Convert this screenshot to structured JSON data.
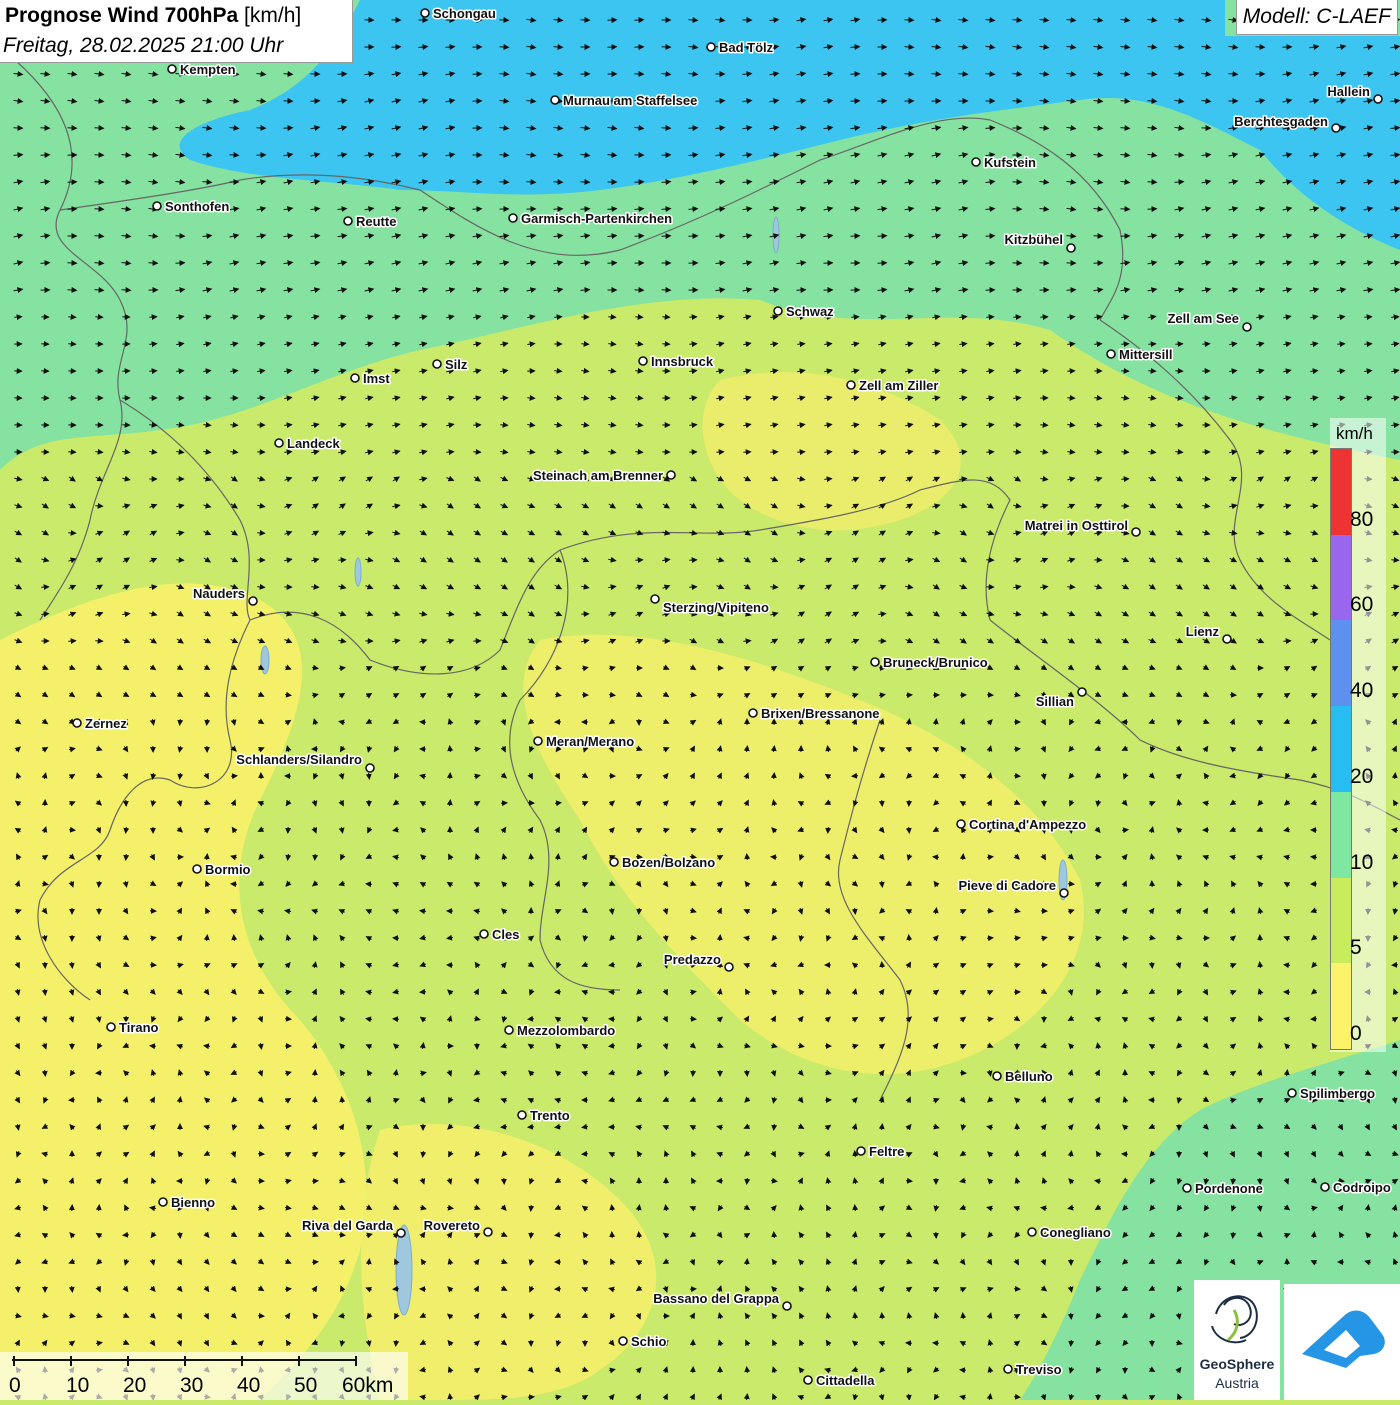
{
  "header": {
    "title_bold": "Prognose Wind 700hPa",
    "title_unit": "[km/h]",
    "datetime": "Freitag, 28.02.2025 21:00 Uhr",
    "model": "Modell: C-LAEF"
  },
  "legend": {
    "unit": "km/h",
    "labels": [
      "0",
      "5",
      "10",
      "20",
      "40",
      "60",
      "80"
    ],
    "colors": [
      "#fdf36a",
      "#c8ec5c",
      "#7fe8a0",
      "#27bdf0",
      "#5e90f0",
      "#9966ee",
      "#ee3333"
    ]
  },
  "scale_bar": {
    "labels": [
      "0",
      "10",
      "20",
      "30",
      "40",
      "50",
      "60km"
    ]
  },
  "logos": {
    "geosphere_line1": "GeoSphere",
    "geosphere_line2": "Austria"
  },
  "cities": [
    {
      "name": "Schongau"
    },
    {
      "name": "Bad Tölz"
    },
    {
      "name": "Kempten"
    },
    {
      "name": "Murnau am Staffelsee"
    },
    {
      "name": "Hallein"
    },
    {
      "name": "Berchtesgaden"
    },
    {
      "name": "Kufstein"
    },
    {
      "name": "Sonthofen"
    },
    {
      "name": "Reutte"
    },
    {
      "name": "Garmisch-Partenkirchen"
    },
    {
      "name": "Kitzbühel"
    },
    {
      "name": "Schwaz"
    },
    {
      "name": "Zell am See"
    },
    {
      "name": "Mittersill"
    },
    {
      "name": "Imst"
    },
    {
      "name": "Silz"
    },
    {
      "name": "Innsbruck"
    },
    {
      "name": "Zell am Ziller"
    },
    {
      "name": "Landeck"
    },
    {
      "name": "Steinach am Brenner"
    },
    {
      "name": "Matrei in Osttirol"
    },
    {
      "name": "Nauders"
    },
    {
      "name": "Sterzing/Vipiteno"
    },
    {
      "name": "Lienz"
    },
    {
      "name": "Bruneck/Brunico"
    },
    {
      "name": "Sillian"
    },
    {
      "name": "Zernez"
    },
    {
      "name": "Brixen/Bressanone"
    },
    {
      "name": "Meran/Merano"
    },
    {
      "name": "Schlanders/Silandro"
    },
    {
      "name": "Cortina d'Ampezzo"
    },
    {
      "name": "Bozen/Bolzano"
    },
    {
      "name": "Bormio"
    },
    {
      "name": "Pieve di Cadore"
    },
    {
      "name": "Cles"
    },
    {
      "name": "Predazzo"
    },
    {
      "name": "Tirano"
    },
    {
      "name": "Mezzolombardo"
    },
    {
      "name": "Belluno"
    },
    {
      "name": "Spilimbergo"
    },
    {
      "name": "Trento"
    },
    {
      "name": "Feltre"
    },
    {
      "name": "Pordenone"
    },
    {
      "name": "Codroipo"
    },
    {
      "name": "Bienno"
    },
    {
      "name": "Riva del Garda"
    },
    {
      "name": "Rovereto"
    },
    {
      "name": "Conegliano"
    },
    {
      "name": "Bassano del Grappa"
    },
    {
      "name": "Schio"
    },
    {
      "name": "Treviso"
    },
    {
      "name": "Cittadella"
    }
  ]
}
